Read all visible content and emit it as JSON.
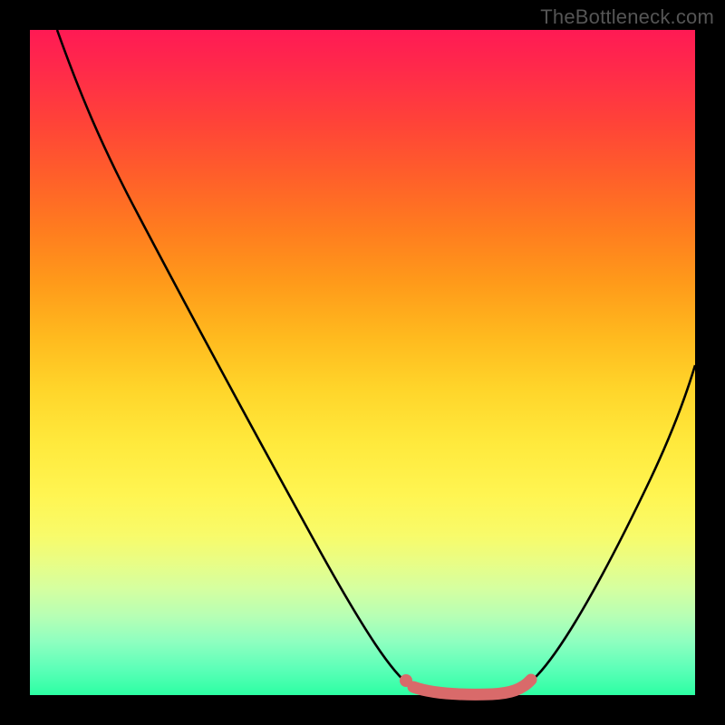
{
  "watermark": "TheBottleneck.com",
  "chart_data": {
    "type": "line",
    "title": "",
    "xlabel": "",
    "ylabel": "",
    "xlim": [
      0,
      100
    ],
    "ylim": [
      0,
      100
    ],
    "grid": false,
    "legend": false,
    "background": {
      "orientation": "vertical",
      "stops": [
        {
          "pos": 0,
          "color": "#ff1a54"
        },
        {
          "pos": 50,
          "color": "#ffe23a"
        },
        {
          "pos": 100,
          "color": "#2cffa3"
        }
      ]
    },
    "series": [
      {
        "name": "bottleneck-curve",
        "color": "#000000",
        "stroke_width": 2,
        "x": [
          4,
          10,
          20,
          30,
          40,
          50,
          55,
          58,
          62,
          66,
          70,
          75,
          80,
          85,
          90,
          95,
          100
        ],
        "y": [
          100,
          88,
          70,
          53,
          36,
          18,
          9,
          4,
          1,
          0,
          0,
          2,
          8,
          17,
          28,
          40,
          53
        ]
      },
      {
        "name": "flat-segment-highlight",
        "color": "#e06666",
        "stroke_width": 10,
        "x": [
          58,
          62,
          66,
          70,
          72
        ],
        "y": [
          1,
          0.5,
          0,
          0.5,
          2
        ]
      }
    ],
    "annotations": [
      {
        "name": "marker-dot",
        "type": "point",
        "x": 57,
        "y": 2,
        "color": "#e06666",
        "radius": 6
      }
    ]
  }
}
